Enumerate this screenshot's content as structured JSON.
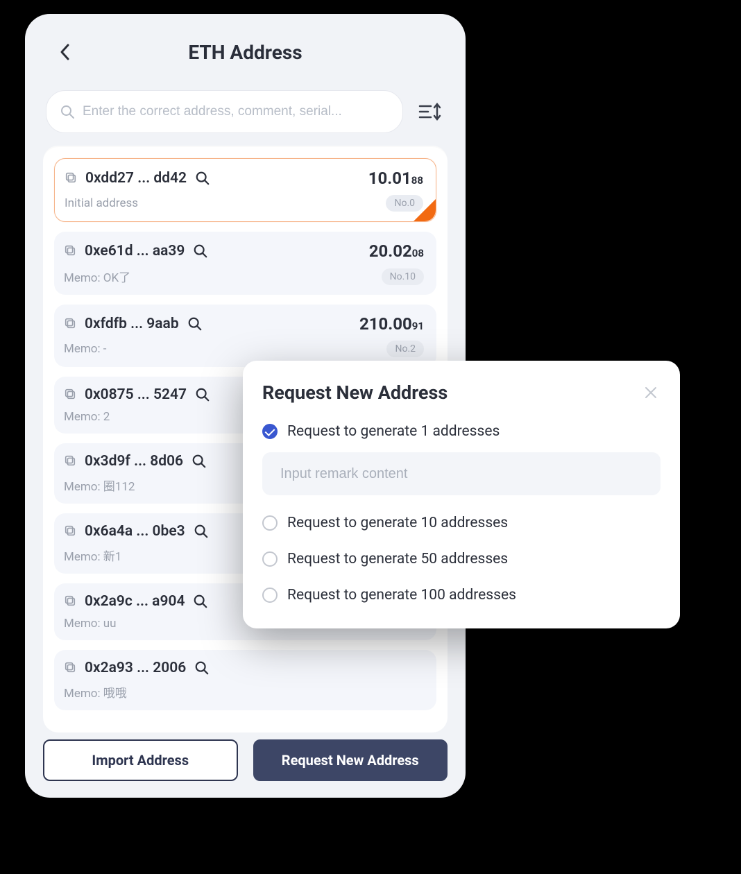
{
  "header": {
    "title": "ETH Address"
  },
  "search": {
    "placeholder": "Enter the correct address, comment, serial..."
  },
  "addresses": [
    {
      "addr": "0xdd27 ... dd42",
      "balance_int": "10.01",
      "balance_frac": "88",
      "memo": "Initial address",
      "badge": "No.0",
      "selected": true
    },
    {
      "addr": "0xe61d ... aa39",
      "balance_int": "20.02",
      "balance_frac": "08",
      "memo": "Memo: OK了",
      "badge": "No.10",
      "selected": false
    },
    {
      "addr": "0xfdfb ... 9aab",
      "balance_int": "210.00",
      "balance_frac": "91",
      "memo": "Memo: -",
      "badge": "No.2",
      "selected": false
    },
    {
      "addr": "0x0875 ... 5247",
      "balance_int": "",
      "balance_frac": "",
      "memo": "Memo: 2",
      "badge": "",
      "selected": false
    },
    {
      "addr": "0x3d9f ... 8d06",
      "balance_int": "",
      "balance_frac": "",
      "memo": "Memo: 圈112",
      "badge": "",
      "selected": false
    },
    {
      "addr": "0x6a4a ... 0be3",
      "balance_int": "",
      "balance_frac": "",
      "memo": "Memo: 新1",
      "badge": "",
      "selected": false
    },
    {
      "addr": "0x2a9c ... a904",
      "balance_int": "",
      "balance_frac": "",
      "memo": "Memo: uu",
      "badge": "",
      "selected": false
    },
    {
      "addr": "0x2a93 ... 2006",
      "balance_int": "",
      "balance_frac": "",
      "memo": "Memo: 哦哦",
      "badge": "",
      "selected": false
    }
  ],
  "actions": {
    "import": "Import Address",
    "request": "Request New Address"
  },
  "modal": {
    "title": "Request New Address",
    "remark_placeholder": "Input remark content",
    "options": [
      {
        "label": "Request to generate 1 addresses",
        "selected": true
      },
      {
        "label": "Request to generate 10 addresses",
        "selected": false
      },
      {
        "label": "Request to generate 50 addresses",
        "selected": false
      },
      {
        "label": "Request to generate 100 addresses",
        "selected": false
      }
    ]
  }
}
